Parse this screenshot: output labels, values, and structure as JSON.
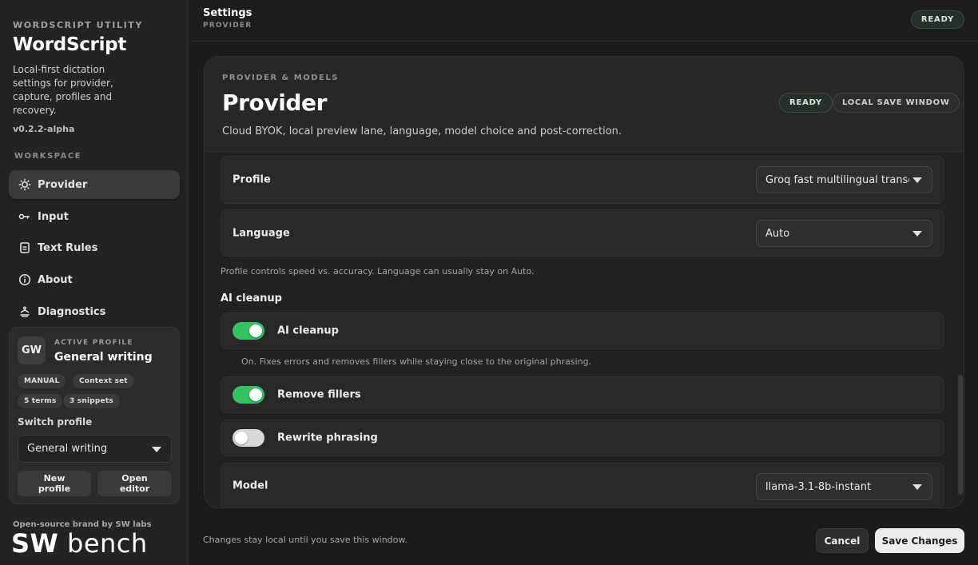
{
  "sidebar": {
    "kicker": "WORDSCRIPT UTILITY",
    "app_name": "WordScript",
    "description": "Local-first dictation settings for provider, capture, profiles and recovery.",
    "version": "v0.2.2-alpha",
    "section_label": "WORKSPACE",
    "nav": [
      {
        "label": "Provider",
        "icon": "sun-gear-icon",
        "active": true
      },
      {
        "label": "Input",
        "icon": "key-input-icon",
        "active": false
      },
      {
        "label": "Text Rules",
        "icon": "document-icon",
        "active": false
      },
      {
        "label": "About",
        "icon": "info-icon",
        "active": false
      },
      {
        "label": "Diagnostics",
        "icon": "stethoscope-icon",
        "active": false
      }
    ],
    "profile_card": {
      "avatar": "GW",
      "kicker": "ACTIVE PROFILE",
      "name": "General writing",
      "chips": [
        "MANUAL",
        "Context set",
        "5 terms",
        "3 snippets"
      ],
      "switch_label": "Switch profile",
      "switch_value": "General writing",
      "new_profile": "New profile",
      "open_editor": "Open editor"
    },
    "footer_note": "Open-source brand by SW labs",
    "footer_logo_bold": "SW",
    "footer_logo_light": "bench"
  },
  "header": {
    "title": "Settings",
    "subtitle": "PROVIDER",
    "status": "READY"
  },
  "panel": {
    "kicker": "PROVIDER & MODELS",
    "title": "Provider",
    "description": "Cloud BYOK, local preview lane, language, model choice and post-correction.",
    "status": "READY",
    "save_scope": "LOCAL SAVE WINDOW",
    "profile": {
      "label": "Profile",
      "value": "Groq fast multilingual transc"
    },
    "language": {
      "label": "Language",
      "value": "Auto"
    },
    "helper": "Profile controls speed vs. accuracy. Language can usually stay on Auto.",
    "ai_section": "AI cleanup",
    "ai_cleanup": {
      "label": "AI cleanup",
      "on": true
    },
    "ai_helper": "On. Fixes errors and removes fillers while staying close to the original phrasing.",
    "remove_fillers": {
      "label": "Remove fillers",
      "on": true
    },
    "rewrite_phrasing": {
      "label": "Rewrite phrasing",
      "on": false
    },
    "model": {
      "label": "Model",
      "value": "llama-3.1-8b-instant"
    }
  },
  "footer": {
    "note": "Changes stay local until you save this window.",
    "cancel": "Cancel",
    "save": "Save Changes"
  },
  "colors": {
    "accent_toggle": "#33c163",
    "background": "#1b1b1b",
    "ready_pill": "#25302b"
  }
}
